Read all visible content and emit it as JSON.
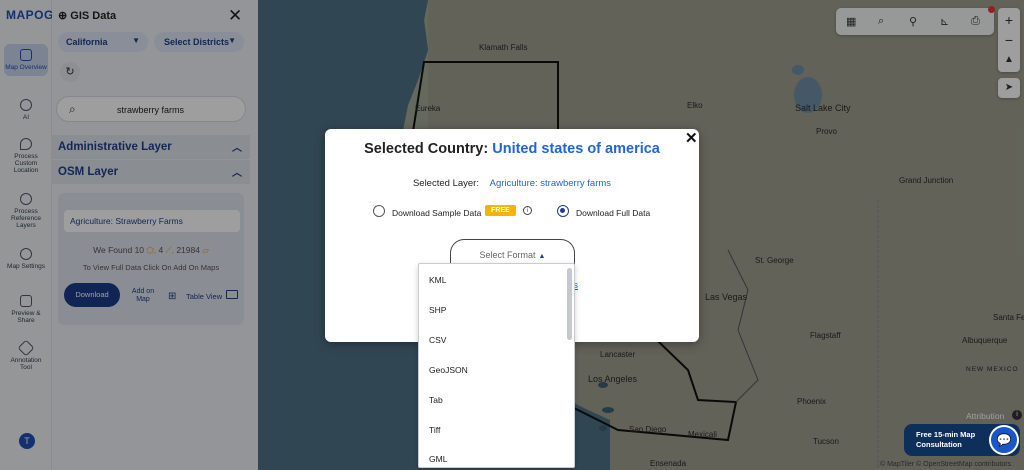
{
  "app": {
    "logo": "MAPOG",
    "avatar_initial": "T"
  },
  "rail": [
    {
      "label": "Map Overview",
      "icon": "map-icon",
      "active": true
    },
    {
      "label": "AI",
      "icon": "ai-icon",
      "active": false
    },
    {
      "label": "Process Custom Location",
      "icon": "location-pin-icon",
      "active": false
    },
    {
      "label": "Process Reference Layers",
      "icon": "layers-gear-icon",
      "active": false
    },
    {
      "label": "Map Settings",
      "icon": "settings-icon",
      "active": false
    },
    {
      "label": "Preview & Share",
      "icon": "preview-icon",
      "active": false
    },
    {
      "label": "Annotation Tool",
      "icon": "pen-icon",
      "active": false
    }
  ],
  "panel": {
    "title": "GIS Data",
    "state_select": "California",
    "district_select": "Select Districts",
    "search_value": "strawberry farms",
    "admin_layer": "Administrative Layer",
    "osm_layer": "OSM Layer",
    "card": {
      "title": "Agriculture: Strawberry Farms",
      "found_prefix": "We Found",
      "count_a": "10",
      "count_b": "4",
      "count_c": "21984",
      "full_text": "To View Full Data Click On Add On Maps",
      "download": "Download",
      "add_on_map": "Add on Map",
      "table_view": "Table View"
    }
  },
  "map": {
    "labels": {
      "klamath": "Klamath Falls",
      "eureka": "Eureka",
      "elko": "Elko",
      "saltlake": "Salt Lake City",
      "provo": "Provo",
      "grandjunction": "Grand Junction",
      "stgeorge": "St. George",
      "lasvegas": "Las Vegas",
      "flagstaff": "Flagstaff",
      "santafe": "Santa Fe",
      "albuquerque": "Albuquerque",
      "lancaster": "Lancaster",
      "losangeles": "Los Angeles",
      "sandiego": "San Diego",
      "mexicali": "Mexicali",
      "phoenix": "Phoenix",
      "tucson": "Tucson",
      "ensenada": "Ensenada",
      "newmexico": "NEW MEXICO"
    },
    "attribution": "Attribution",
    "copyright": "© MapTiler © OpenStreetMap contributors",
    "consult": "Free 15-min Map Consultation"
  },
  "modal": {
    "title_prefix": "Selected Country:",
    "country": "United states of america",
    "layer_prefix": "Selected Layer:",
    "layer": "Agriculture: strawberry farms",
    "sample": "Download Sample Data",
    "free_badge": "FREE",
    "full": "Download Full Data",
    "format_placeholder": "Select Format",
    "partial_link": "es"
  },
  "formats": [
    "KML",
    "SHP",
    "CSV",
    "GeoJSON",
    "Tab",
    "Tiff",
    "GML"
  ],
  "colors": {
    "brand": "#1f4fb5",
    "accent": "#1f64d8",
    "badge": "#f5b400",
    "consult_bg": "#0e2f5a"
  }
}
